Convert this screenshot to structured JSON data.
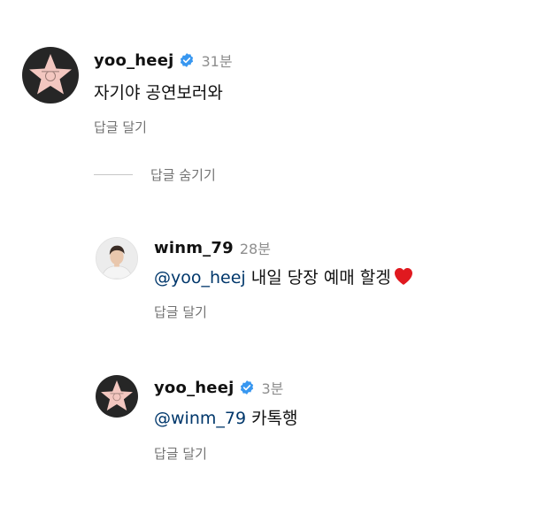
{
  "colors": {
    "text": "#111111",
    "secondary": "#737373",
    "timestamp": "#8e8e8e",
    "mention": "#00376b",
    "verified": "#3897f0",
    "star": "#f3c7c0",
    "avatar_dark": "#262626",
    "heart": "#e0191f"
  },
  "comments": [
    {
      "username": "yoo_heej",
      "verified": true,
      "time": "31분",
      "text": "자기야 공연보러와",
      "reply_label": "답글 달기",
      "avatar_icon": "hollywood-star-icon"
    },
    {
      "username": "winm_79",
      "verified": false,
      "time": "28분",
      "mention": "@yoo_heej",
      "text": "내일 당장 예매 할겡",
      "emoji_icon": "red-heart-icon",
      "reply_label": "답글 달기",
      "avatar_icon": "profile-photo"
    },
    {
      "username": "yoo_heej",
      "verified": true,
      "time": "3분",
      "mention": "@winm_79",
      "text": "카톡행",
      "reply_label": "답글 달기",
      "avatar_icon": "hollywood-star-icon"
    }
  ],
  "hide_replies_label": "답글 숨기기"
}
